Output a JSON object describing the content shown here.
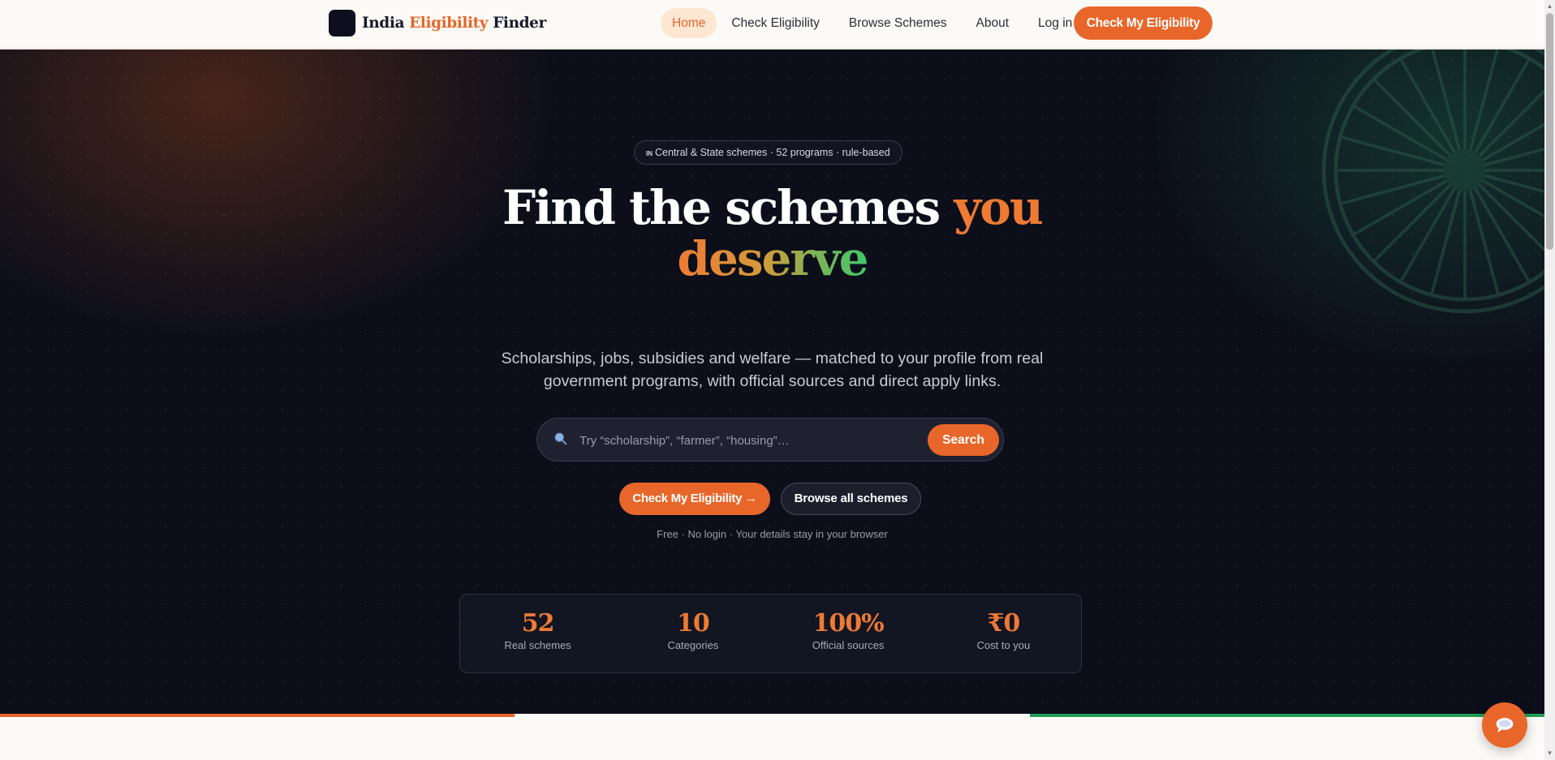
{
  "brand": {
    "name_part1": "India",
    "name_part2": "Eligibility",
    "name_part3": "Finder"
  },
  "nav": {
    "items": [
      {
        "label": "Home",
        "active": true
      },
      {
        "label": "Check Eligibility"
      },
      {
        "label": "Browse Schemes"
      },
      {
        "label": "About"
      },
      {
        "label": "Log in"
      }
    ],
    "cta_label": "Check My Eligibility"
  },
  "hero": {
    "pill_flag": "IN",
    "pill_text": "Central & State schemes · 52 programs · rule-based",
    "title_line1": "Find the schemes",
    "title_you": "you",
    "title_line2": "deserve",
    "subtitle_line1": "Scholarships, jobs, subsidies and welfare — matched to your profile from real",
    "subtitle_line2": "government programs, with official sources and direct apply links.",
    "search_placeholder": "Try “scholarship”, “farmer”, “housing”…",
    "search_button": "Search",
    "primary_button": "Check My Eligibility →",
    "secondary_button": "Browse all schemes",
    "note": "Free · No login · Your details stay in your browser"
  },
  "stats": [
    {
      "value": "52",
      "label": "Real schemes"
    },
    {
      "value": "10",
      "label": "Categories"
    },
    {
      "value": "100%",
      "label": "Official sources"
    },
    {
      "value": "₹0",
      "label": "Cost to you"
    }
  ],
  "colors": {
    "accent": "#e8662a",
    "saffron": "#e8662a",
    "white": "#ffffff",
    "green": "#1f9d55",
    "hero_bg": "#0c0e1a"
  },
  "icons": {
    "search": "search-icon",
    "chat": "chat-icon"
  }
}
